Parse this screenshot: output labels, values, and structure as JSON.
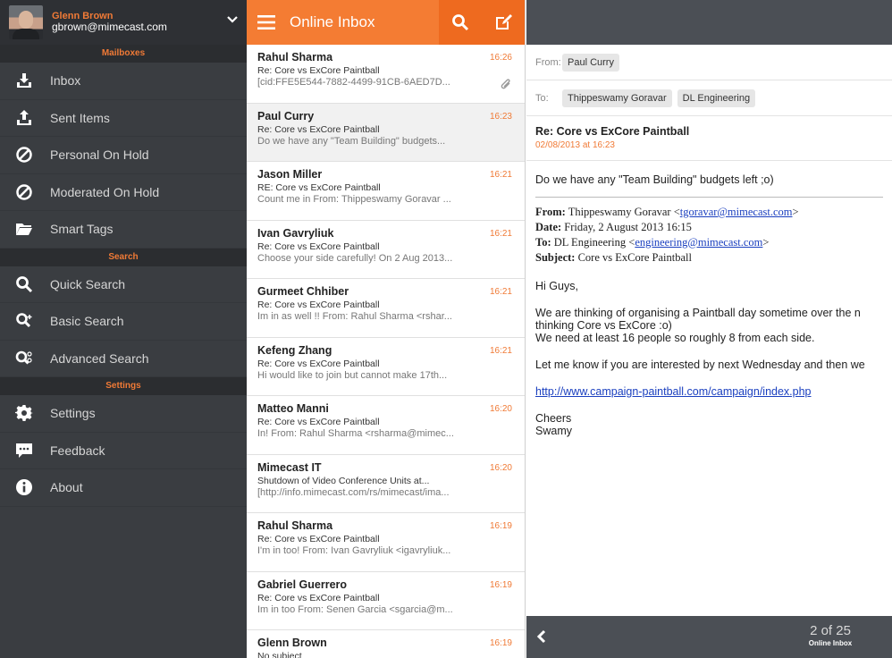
{
  "account": {
    "name": "Glenn Brown",
    "email": "gbrown@mimecast.com"
  },
  "sidebar": {
    "mailboxes_header": "Mailboxes",
    "mailboxes": [
      {
        "label": "Inbox",
        "icon": "inbox-download-icon"
      },
      {
        "label": "Sent Items",
        "icon": "sent-upload-icon"
      },
      {
        "label": "Personal On Hold",
        "icon": "hold-prohibited-icon"
      },
      {
        "label": "Moderated On Hold",
        "icon": "hold-prohibited-icon"
      },
      {
        "label": "Smart Tags",
        "icon": "folder-icon"
      }
    ],
    "search_header": "Search",
    "search": [
      {
        "label": "Quick Search",
        "icon": "search-icon"
      },
      {
        "label": "Basic Search",
        "icon": "search-plus-icon"
      },
      {
        "label": "Advanced Search",
        "icon": "search-advanced-icon"
      }
    ],
    "settings_header": "Settings",
    "settings": [
      {
        "label": "Settings",
        "icon": "gear-icon"
      },
      {
        "label": "Feedback",
        "icon": "chat-bubble-icon"
      },
      {
        "label": "About",
        "icon": "info-icon"
      }
    ]
  },
  "list": {
    "title": "Online Inbox",
    "messages": [
      {
        "sender": "Rahul Sharma",
        "time": "16:26",
        "subject": "Re: Core vs ExCore Paintball",
        "preview": "[cid:FFE5E544-7882-4499-91CB-6AED7D...",
        "attachment": true
      },
      {
        "sender": "Paul Curry",
        "time": "16:23",
        "subject": "Re: Core vs ExCore Paintball",
        "preview": "Do we have any \"Team Building\" budgets...",
        "selected": true
      },
      {
        "sender": "Jason Miller",
        "time": "16:21",
        "subject": "RE: Core vs ExCore Paintball",
        "preview": "Count me in  From: Thippeswamy Goravar ..."
      },
      {
        "sender": "Ivan Gavryliuk",
        "time": "16:21",
        "subject": "Re: Core vs ExCore Paintball",
        "preview": "Choose your side carefully!  On 2 Aug 2013..."
      },
      {
        "sender": "Gurmeet Chhiber",
        "time": "16:21",
        "subject": "Re: Core vs ExCore Paintball",
        "preview": "Im in as well !!  From: Rahul Sharma <rshar..."
      },
      {
        "sender": "Kefeng Zhang",
        "time": "16:21",
        "subject": "Re: Core vs ExCore Paintball",
        "preview": "Hi would like to join but cannot make 17th..."
      },
      {
        "sender": "Matteo Manni",
        "time": "16:20",
        "subject": "Re: Core vs ExCore Paintball",
        "preview": "In!  From: Rahul Sharma <rsharma@mimec..."
      },
      {
        "sender": "Mimecast IT",
        "time": "16:20",
        "subject": "Shutdown of Video Conference Units at...",
        "preview": "[http://info.mimecast.com/rs/mimecast/ima..."
      },
      {
        "sender": "Rahul Sharma",
        "time": "16:19",
        "subject": "Re: Core vs ExCore Paintball",
        "preview": "I'm in too!  From: Ivan Gavryliuk <igavryliuk..."
      },
      {
        "sender": "Gabriel Guerrero",
        "time": "16:19",
        "subject": "Re: Core vs ExCore Paintball",
        "preview": "Im in too  From: Senen Garcia <sgarcia@m..."
      },
      {
        "sender": "Glenn Brown",
        "time": "16:19",
        "subject": "No subject",
        "preview": ""
      }
    ]
  },
  "reader": {
    "from_label": "From:",
    "from": "Paul Curry",
    "to_label": "To:",
    "to": [
      "Thippeswamy Goravar",
      "DL Engineering"
    ],
    "subject": "Re: Core vs ExCore Paintball",
    "date": "02/08/2013 at 16:23",
    "reply_line": "Do we have any \"Team Building\" budgets left ;o)",
    "quote": {
      "from_label": "From:",
      "from_name": "Thippeswamy Goravar <",
      "from_email": "tgoravar@mimecast.com",
      "from_end": ">",
      "date_label": "Date:",
      "date": "Friday, 2 August 2013 16:15",
      "to_label": "To:",
      "to_name": "DL Engineering <",
      "to_email": "engineering@mimecast.com",
      "to_end": ">",
      "subject_label": "Subject:",
      "subject": "Core vs ExCore Paintball"
    },
    "greeting": "Hi Guys,",
    "para1_l1": "We are thinking of organising a Paintball day sometime over the n",
    "para1_l2": "thinking Core vs ExCore :o)",
    "para1_l3": "We need at least 16 people so roughly 8 from each side.",
    "para2": "Let me know if you are interested by next Wednesday and then we",
    "link": "http://www.campaign-paintball.com/campaign/index.php",
    "signoff": "Cheers",
    "signature": "Swamy",
    "pager_count": "2 of 25",
    "pager_label": "Online Inbox"
  }
}
